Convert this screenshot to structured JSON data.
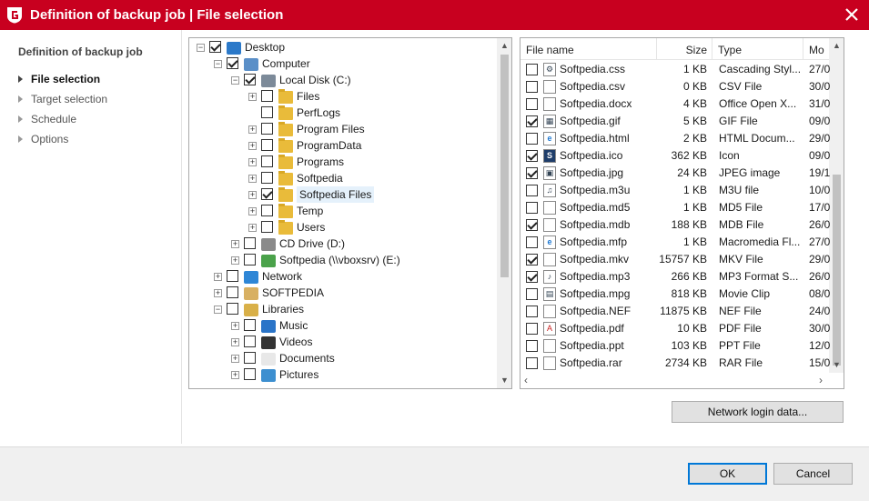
{
  "window": {
    "title": "Definition of backup job | File selection"
  },
  "nav": {
    "heading": "Definition of backup job",
    "items": [
      {
        "label": "File selection",
        "active": true
      },
      {
        "label": "Target selection",
        "active": false
      },
      {
        "label": "Schedule",
        "active": false
      },
      {
        "label": "Options",
        "active": false
      }
    ]
  },
  "tree": {
    "items": [
      {
        "label": "Desktop",
        "icon": "desktop-icon",
        "checked": true,
        "expander": "minus"
      },
      {
        "label": "Computer",
        "icon": "computer-icon",
        "checked": true,
        "expander": "minus"
      },
      {
        "label": "Local Disk (C:)",
        "icon": "drive-icon",
        "checked": true,
        "expander": "minus"
      },
      {
        "label": "Files",
        "icon": "folder-icon",
        "checked": false,
        "expander": "plus"
      },
      {
        "label": "PerfLogs",
        "icon": "folder-icon",
        "checked": false,
        "expander": "none"
      },
      {
        "label": "Program Files",
        "icon": "folder-icon",
        "checked": false,
        "expander": "plus"
      },
      {
        "label": "ProgramData",
        "icon": "folder-icon",
        "checked": false,
        "expander": "plus"
      },
      {
        "label": "Programs",
        "icon": "folder-icon",
        "checked": false,
        "expander": "plus"
      },
      {
        "label": "Softpedia",
        "icon": "folder-icon",
        "checked": false,
        "expander": "plus"
      },
      {
        "label": "Softpedia Files",
        "icon": "folder-icon",
        "checked": true,
        "expander": "plus",
        "selected": true
      },
      {
        "label": "Temp",
        "icon": "folder-icon",
        "checked": false,
        "expander": "plus"
      },
      {
        "label": "Users",
        "icon": "folder-icon",
        "checked": false,
        "expander": "plus"
      },
      {
        "label": "CD Drive (D:)",
        "icon": "cd-drive-icon",
        "checked": false,
        "expander": "plus"
      },
      {
        "label": "Softpedia (\\\\vboxsrv) (E:)",
        "icon": "network-drive-icon",
        "checked": false,
        "expander": "plus"
      },
      {
        "label": "Network",
        "icon": "network-icon",
        "checked": false,
        "expander": "plus"
      },
      {
        "label": "SOFTPEDIA",
        "icon": "user-folder-icon",
        "checked": false,
        "expander": "plus"
      },
      {
        "label": "Libraries",
        "icon": "libraries-icon",
        "checked": false,
        "expander": "minus"
      },
      {
        "label": "Music",
        "icon": "music-icon",
        "checked": false,
        "expander": "plus"
      },
      {
        "label": "Videos",
        "icon": "video-icon",
        "checked": false,
        "expander": "plus"
      },
      {
        "label": "Documents",
        "icon": "documents-icon",
        "checked": false,
        "expander": "plus"
      },
      {
        "label": "Pictures",
        "icon": "pictures-icon",
        "checked": false,
        "expander": "plus"
      }
    ]
  },
  "files": {
    "columns": {
      "name": "File name",
      "size": "Size",
      "type": "Type",
      "modified": "Mo"
    },
    "rows": [
      {
        "name": "Softpedia.css",
        "size": "1 KB",
        "type": "Cascading Styl...",
        "modified": "27/0",
        "checked": false,
        "icon": "css-file-icon",
        "glyph": "⚙"
      },
      {
        "name": "Softpedia.csv",
        "size": "0 KB",
        "type": "CSV File",
        "modified": "30/0",
        "checked": false,
        "icon": "file-icon",
        "glyph": ""
      },
      {
        "name": "Softpedia.docx",
        "size": "4 KB",
        "type": "Office Open X...",
        "modified": "31/0",
        "checked": false,
        "icon": "file-icon",
        "glyph": ""
      },
      {
        "name": "Softpedia.gif",
        "size": "5 KB",
        "type": "GIF File",
        "modified": "09/0",
        "checked": true,
        "icon": "image-file-icon",
        "glyph": "▦"
      },
      {
        "name": "Softpedia.html",
        "size": "2 KB",
        "type": "HTML Docum...",
        "modified": "29/0",
        "checked": false,
        "icon": "ie-file-icon",
        "glyph": "e"
      },
      {
        "name": "Softpedia.ico",
        "size": "362 KB",
        "type": "Icon",
        "modified": "09/0",
        "checked": true,
        "icon": "softpedia-icon",
        "glyph": "S"
      },
      {
        "name": "Softpedia.jpg",
        "size": "24 KB",
        "type": "JPEG image",
        "modified": "19/1",
        "checked": true,
        "icon": "image-file-icon",
        "glyph": "▣"
      },
      {
        "name": "Softpedia.m3u",
        "size": "1 KB",
        "type": "M3U file",
        "modified": "10/0",
        "checked": false,
        "icon": "playlist-file-icon",
        "glyph": "♫"
      },
      {
        "name": "Softpedia.md5",
        "size": "1 KB",
        "type": "MD5 File",
        "modified": "17/0",
        "checked": false,
        "icon": "file-icon",
        "glyph": ""
      },
      {
        "name": "Softpedia.mdb",
        "size": "188 KB",
        "type": "MDB File",
        "modified": "26/0",
        "checked": true,
        "icon": "file-icon",
        "glyph": ""
      },
      {
        "name": "Softpedia.mfp",
        "size": "1 KB",
        "type": "Macromedia Fl...",
        "modified": "27/0",
        "checked": false,
        "icon": "ie-file-icon",
        "glyph": "e"
      },
      {
        "name": "Softpedia.mkv",
        "size": "15757 KB",
        "type": "MKV File",
        "modified": "29/0",
        "checked": true,
        "icon": "file-icon",
        "glyph": ""
      },
      {
        "name": "Softpedia.mp3",
        "size": "266 KB",
        "type": "MP3 Format S...",
        "modified": "26/0",
        "checked": true,
        "icon": "audio-file-icon",
        "glyph": "♪"
      },
      {
        "name": "Softpedia.mpg",
        "size": "818 KB",
        "type": "Movie Clip",
        "modified": "08/0",
        "checked": false,
        "icon": "video-file-icon",
        "glyph": "▤"
      },
      {
        "name": "Softpedia.NEF",
        "size": "11875 KB",
        "type": "NEF File",
        "modified": "24/0",
        "checked": false,
        "icon": "file-icon",
        "glyph": ""
      },
      {
        "name": "Softpedia.pdf",
        "size": "10 KB",
        "type": "PDF File",
        "modified": "30/0",
        "checked": false,
        "icon": "pdf-file-icon",
        "glyph": "A"
      },
      {
        "name": "Softpedia.ppt",
        "size": "103 KB",
        "type": "PPT File",
        "modified": "12/0",
        "checked": false,
        "icon": "file-icon",
        "glyph": ""
      },
      {
        "name": "Softpedia.rar",
        "size": "2734 KB",
        "type": "RAR File",
        "modified": "15/0",
        "checked": false,
        "icon": "file-icon",
        "glyph": ""
      }
    ]
  },
  "buttons": {
    "network_login": "Network login data...",
    "ok": "OK",
    "cancel": "Cancel"
  },
  "colors": {
    "titlebar": "#c8001f",
    "accent": "#0078d7"
  }
}
